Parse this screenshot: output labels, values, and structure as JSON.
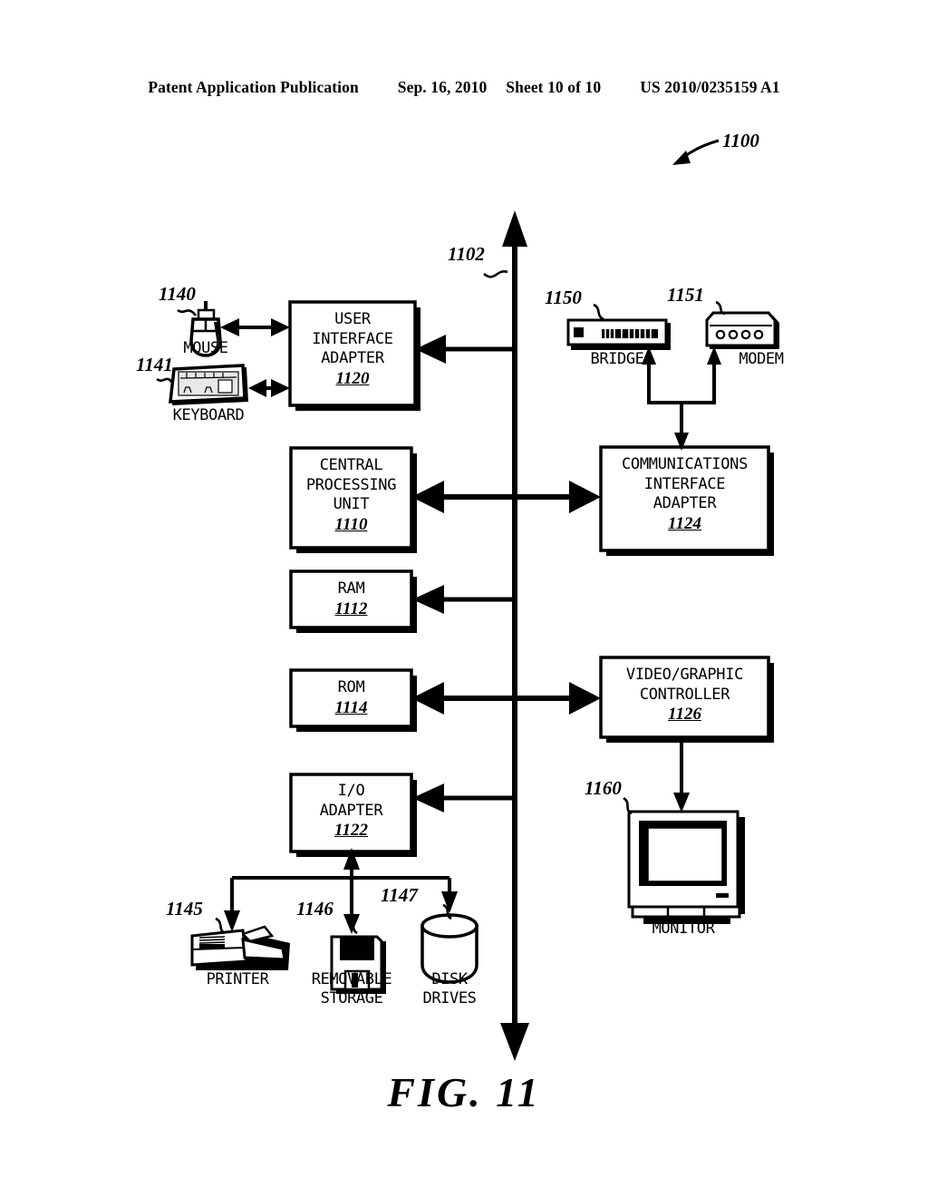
{
  "header": {
    "publication": "Patent Application Publication",
    "date": "Sep. 16, 2010",
    "sheet": "Sheet 10 of 10",
    "patent_number": "US 2010/0235159 A1"
  },
  "figure": {
    "caption": "FIG. 11",
    "system_ref": "1100",
    "bus_ref": "1102"
  },
  "boxes": [
    {
      "key": "user_interface_adapter",
      "lines": [
        "USER",
        "INTERFACE",
        "ADAPTER"
      ],
      "ref": "1120"
    },
    {
      "key": "central_processing_unit",
      "lines": [
        "CENTRAL",
        "PROCESSING",
        "UNIT"
      ],
      "ref": "1110"
    },
    {
      "key": "ram",
      "lines": [
        "RAM"
      ],
      "ref": "1112"
    },
    {
      "key": "rom",
      "lines": [
        "ROM"
      ],
      "ref": "1114"
    },
    {
      "key": "io_adapter",
      "lines": [
        "I/O",
        "ADAPTER"
      ],
      "ref": "1122"
    },
    {
      "key": "communications_interface_adapter",
      "lines": [
        "COMMUNICATIONS",
        "INTERFACE",
        "ADAPTER"
      ],
      "ref": "1124"
    },
    {
      "key": "video_graphic_controller",
      "lines": [
        "VIDEO/GRAPHIC",
        "CONTROLLER"
      ],
      "ref": "1126"
    }
  ],
  "devices": [
    {
      "key": "mouse",
      "label": "MOUSE",
      "ref": "1140"
    },
    {
      "key": "keyboard",
      "label": "KEYBOARD",
      "ref": "1141"
    },
    {
      "key": "printer",
      "label": "PRINTER",
      "ref": "1145"
    },
    {
      "key": "removable_storage",
      "label": "REMOVABLE\nSTORAGE",
      "ref": "1146"
    },
    {
      "key": "disk_drives",
      "label": "DISK\nDRIVES",
      "ref": "1147"
    },
    {
      "key": "bridge",
      "label": "BRIDGE",
      "ref": "1150"
    },
    {
      "key": "modem",
      "label": "MODEM",
      "ref": "1151"
    },
    {
      "key": "monitor",
      "label": "MONITOR",
      "ref": "1160"
    }
  ],
  "device_labels": {
    "mouse": "MOUSE",
    "keyboard": "KEYBOARD",
    "printer": "PRINTER",
    "removable_storage_line1": "REMOVABLE",
    "removable_storage_line2": "STORAGE",
    "disk_drives_line1": "DISK",
    "disk_drives_line2": "DRIVES",
    "bridge": "BRIDGE",
    "modem": "MODEM",
    "monitor": "MONITOR"
  },
  "box_text": {
    "uia_l1": "USER",
    "uia_l2": "INTERFACE",
    "uia_l3": "ADAPTER",
    "uia_ref": "1120",
    "cpu_l1": "CENTRAL",
    "cpu_l2": "PROCESSING",
    "cpu_l3": "UNIT",
    "cpu_ref": "1110",
    "ram_l1": "RAM",
    "ram_ref": "1112",
    "rom_l1": "ROM",
    "rom_ref": "1114",
    "io_l1": "I/O",
    "io_l2": "ADAPTER",
    "io_ref": "1122",
    "cia_l1": "COMMUNICATIONS",
    "cia_l2": "INTERFACE",
    "cia_l3": "ADAPTER",
    "cia_ref": "1124",
    "vgc_l1": "VIDEO/GRAPHIC",
    "vgc_l2": "CONTROLLER",
    "vgc_ref": "1126"
  },
  "refs": {
    "system": "1100",
    "bus": "1102",
    "mouse": "1140",
    "keyboard": "1141",
    "printer": "1145",
    "removable_storage": "1146",
    "disk_drives": "1147",
    "bridge": "1150",
    "modem": "1151",
    "monitor": "1160"
  },
  "colors": {
    "ink": "#000000",
    "paper": "#ffffff",
    "shadow": "#000000"
  }
}
